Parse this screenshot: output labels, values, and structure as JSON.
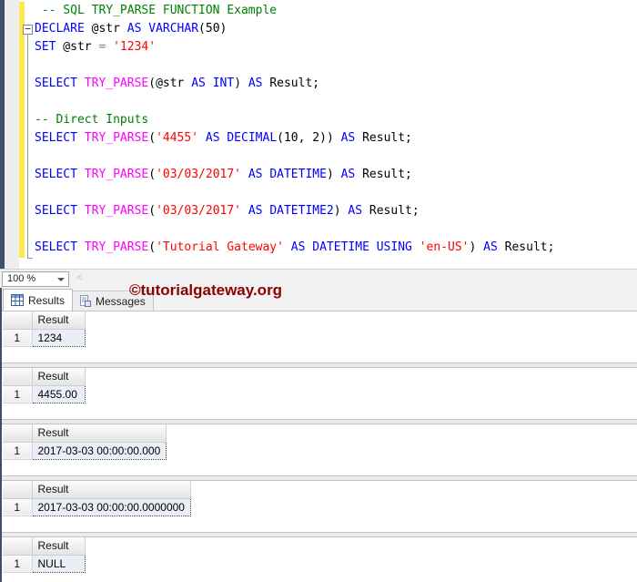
{
  "syntax_colors": {
    "keyword": "#0000ff",
    "comment": "#008000",
    "function": "#ff00ff",
    "string": "#ff0000",
    "plain": "#000000",
    "operator": "#808080"
  },
  "editor": {
    "fold_marker": "−",
    "lines": [
      [
        {
          "t": " -- SQL TRY_PARSE FUNCTION Example",
          "c": "comment"
        }
      ],
      [
        {
          "t": "DECLARE",
          "c": "keyword"
        },
        {
          "t": " @str ",
          "c": "plain"
        },
        {
          "t": "AS",
          "c": "keyword"
        },
        {
          "t": " ",
          "c": "plain"
        },
        {
          "t": "VARCHAR",
          "c": "keyword"
        },
        {
          "t": "(50)",
          "c": "plain"
        }
      ],
      [
        {
          "t": "SET",
          "c": "keyword"
        },
        {
          "t": " @str ",
          "c": "plain"
        },
        {
          "t": "=",
          "c": "operator"
        },
        {
          "t": " ",
          "c": "plain"
        },
        {
          "t": "'1234'",
          "c": "string"
        }
      ],
      [],
      [
        {
          "t": "SELECT",
          "c": "keyword"
        },
        {
          "t": " ",
          "c": "plain"
        },
        {
          "t": "TRY_PARSE",
          "c": "function"
        },
        {
          "t": "(@str ",
          "c": "plain"
        },
        {
          "t": "AS",
          "c": "keyword"
        },
        {
          "t": " ",
          "c": "plain"
        },
        {
          "t": "INT",
          "c": "keyword"
        },
        {
          "t": ") ",
          "c": "plain"
        },
        {
          "t": "AS",
          "c": "keyword"
        },
        {
          "t": " Result;",
          "c": "plain"
        }
      ],
      [],
      [
        {
          "t": "-- Direct Inputs",
          "c": "comment"
        }
      ],
      [
        {
          "t": "SELECT",
          "c": "keyword"
        },
        {
          "t": " ",
          "c": "plain"
        },
        {
          "t": "TRY_PARSE",
          "c": "function"
        },
        {
          "t": "(",
          "c": "plain"
        },
        {
          "t": "'4455'",
          "c": "string"
        },
        {
          "t": " ",
          "c": "plain"
        },
        {
          "t": "AS",
          "c": "keyword"
        },
        {
          "t": " ",
          "c": "plain"
        },
        {
          "t": "DECIMAL",
          "c": "keyword"
        },
        {
          "t": "(10, 2)) ",
          "c": "plain"
        },
        {
          "t": "AS",
          "c": "keyword"
        },
        {
          "t": " Result;",
          "c": "plain"
        }
      ],
      [],
      [
        {
          "t": "SELECT",
          "c": "keyword"
        },
        {
          "t": " ",
          "c": "plain"
        },
        {
          "t": "TRY_PARSE",
          "c": "function"
        },
        {
          "t": "(",
          "c": "plain"
        },
        {
          "t": "'03/03/2017'",
          "c": "string"
        },
        {
          "t": " ",
          "c": "plain"
        },
        {
          "t": "AS",
          "c": "keyword"
        },
        {
          "t": " ",
          "c": "plain"
        },
        {
          "t": "DATETIME",
          "c": "keyword"
        },
        {
          "t": ") ",
          "c": "plain"
        },
        {
          "t": "AS",
          "c": "keyword"
        },
        {
          "t": " Result;",
          "c": "plain"
        }
      ],
      [],
      [
        {
          "t": "SELECT",
          "c": "keyword"
        },
        {
          "t": " ",
          "c": "plain"
        },
        {
          "t": "TRY_PARSE",
          "c": "function"
        },
        {
          "t": "(",
          "c": "plain"
        },
        {
          "t": "'03/03/2017'",
          "c": "string"
        },
        {
          "t": " ",
          "c": "plain"
        },
        {
          "t": "AS",
          "c": "keyword"
        },
        {
          "t": " ",
          "c": "plain"
        },
        {
          "t": "DATETIME2",
          "c": "keyword"
        },
        {
          "t": ") ",
          "c": "plain"
        },
        {
          "t": "AS",
          "c": "keyword"
        },
        {
          "t": " Result;",
          "c": "plain"
        }
      ],
      [],
      [
        {
          "t": "SELECT",
          "c": "keyword"
        },
        {
          "t": " ",
          "c": "plain"
        },
        {
          "t": "TRY_PARSE",
          "c": "function"
        },
        {
          "t": "(",
          "c": "plain"
        },
        {
          "t": "'Tutorial Gateway'",
          "c": "string"
        },
        {
          "t": " ",
          "c": "plain"
        },
        {
          "t": "AS",
          "c": "keyword"
        },
        {
          "t": " ",
          "c": "plain"
        },
        {
          "t": "DATETIME",
          "c": "keyword"
        },
        {
          "t": " ",
          "c": "plain"
        },
        {
          "t": "USING",
          "c": "keyword"
        },
        {
          "t": " ",
          "c": "plain"
        },
        {
          "t": "'en-US'",
          "c": "string"
        },
        {
          "t": ") ",
          "c": "plain"
        },
        {
          "t": "AS",
          "c": "keyword"
        },
        {
          "t": " Result;",
          "c": "plain"
        }
      ]
    ]
  },
  "status_bar": {
    "zoom_value": "100 %",
    "scroll_left_glyph": "<"
  },
  "results_pane": {
    "tabs": [
      {
        "label": "Results",
        "active": true
      },
      {
        "label": "Messages",
        "active": false
      }
    ],
    "watermark": "©tutorialgateway.org",
    "grids": [
      {
        "column_header": "Result",
        "row_number": "1",
        "value": "1234"
      },
      {
        "column_header": "Result",
        "row_number": "1",
        "value": "4455.00"
      },
      {
        "column_header": "Result",
        "row_number": "1",
        "value": "2017-03-03 00:00:00.000"
      },
      {
        "column_header": "Result",
        "row_number": "1",
        "value": "2017-03-03 00:00:00.0000000"
      },
      {
        "column_header": "Result",
        "row_number": "1",
        "value": "NULL"
      }
    ]
  }
}
